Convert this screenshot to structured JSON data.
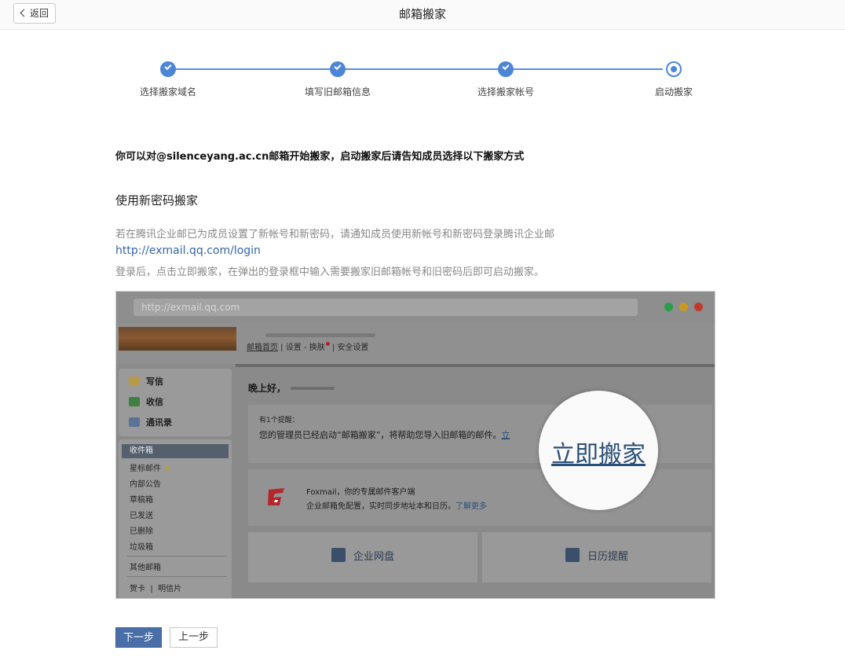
{
  "header": {
    "back_label": "返回",
    "title": "邮箱搬家"
  },
  "steps": [
    {
      "label": "选择搬家域名",
      "state": "done"
    },
    {
      "label": "填写旧邮箱信息",
      "state": "done"
    },
    {
      "label": "选择搬家帐号",
      "state": "done"
    },
    {
      "label": "启动搬家",
      "state": "current"
    }
  ],
  "content": {
    "intro": "你可以对@silenceyang.ac.cn邮箱开始搬家，启动搬家后请告知成员选择以下搬家方式",
    "section_title": "使用新密码搬家",
    "desc1": "若在腾讯企业邮已为成员设置了新帐号和新密码，请通知成员使用新帐号和新密码登录腾讯企业邮",
    "link": "http://exmail.qq.com/login",
    "desc2": "登录后，点击立即搬家，在弹出的登录框中输入需要搬家旧邮箱帐号和旧密码后即可启动搬家。"
  },
  "illustration": {
    "url": "http://exmail.qq.com",
    "window_dot_colors": [
      "#2a9d48",
      "#c99a1e",
      "#c0392b"
    ],
    "nav": {
      "home": "邮箱首页",
      "settings": "设置",
      "skin": "换肤",
      "security": "安全设置"
    },
    "compose": "写信",
    "receive": "收信",
    "contacts": "通讯录",
    "folders": [
      "收件箱",
      "星标邮件",
      "内部公告",
      "草稿箱",
      "已发送",
      "已删除",
      "垃圾箱"
    ],
    "other_mailbox": "其他邮箱",
    "cards": "贺卡",
    "postcards": "明信片",
    "greeting": "晚上好，",
    "notice_count": "有1个提醒：",
    "notice_text": "您的管理员已经启动“邮箱搬家”，将帮助您导入旧邮箱的邮件。",
    "notice_link": "立",
    "foxmail_title": "Foxmail，你的专属邮件客户端",
    "foxmail_desc": "企业邮箱免配置，实时同步地址本和日历。",
    "foxmail_more": "了解更多",
    "netdisk": "企业网盘",
    "calendar": "日历提醒",
    "magnifier_text": "立即搬家"
  },
  "footer": {
    "next_label": "下一步",
    "prev_label": "上一步"
  }
}
